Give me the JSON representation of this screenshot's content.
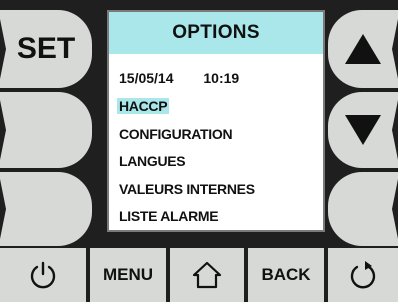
{
  "left_buttons": [
    {
      "label": "SET"
    },
    {
      "label": ""
    },
    {
      "label": ""
    }
  ],
  "right_buttons": [
    {
      "icon": "arrow-up-icon"
    },
    {
      "icon": "arrow-down-icon"
    },
    {
      "icon": ""
    }
  ],
  "panel": {
    "title": "OPTIONS",
    "date": "15/05/14",
    "time": "10:19",
    "items": [
      {
        "label": "HACCP",
        "selected": true
      },
      {
        "label": "CONFIGURATION",
        "selected": false
      },
      {
        "label": "LANGUES",
        "selected": false
      },
      {
        "label": "VALEURS INTERNES",
        "selected": false
      },
      {
        "label": "LISTE ALARME",
        "selected": false
      }
    ]
  },
  "bottom_bar": {
    "power_icon": "power-icon",
    "menu_label": "MENU",
    "home_icon": "home-icon",
    "back_label": "BACK",
    "refresh_icon": "refresh-icon"
  },
  "colors": {
    "panel_header": "#a9e7ea",
    "selection": "#a9e7ea",
    "button_face": "#d7d9d6",
    "background": "#1f1f1f"
  }
}
